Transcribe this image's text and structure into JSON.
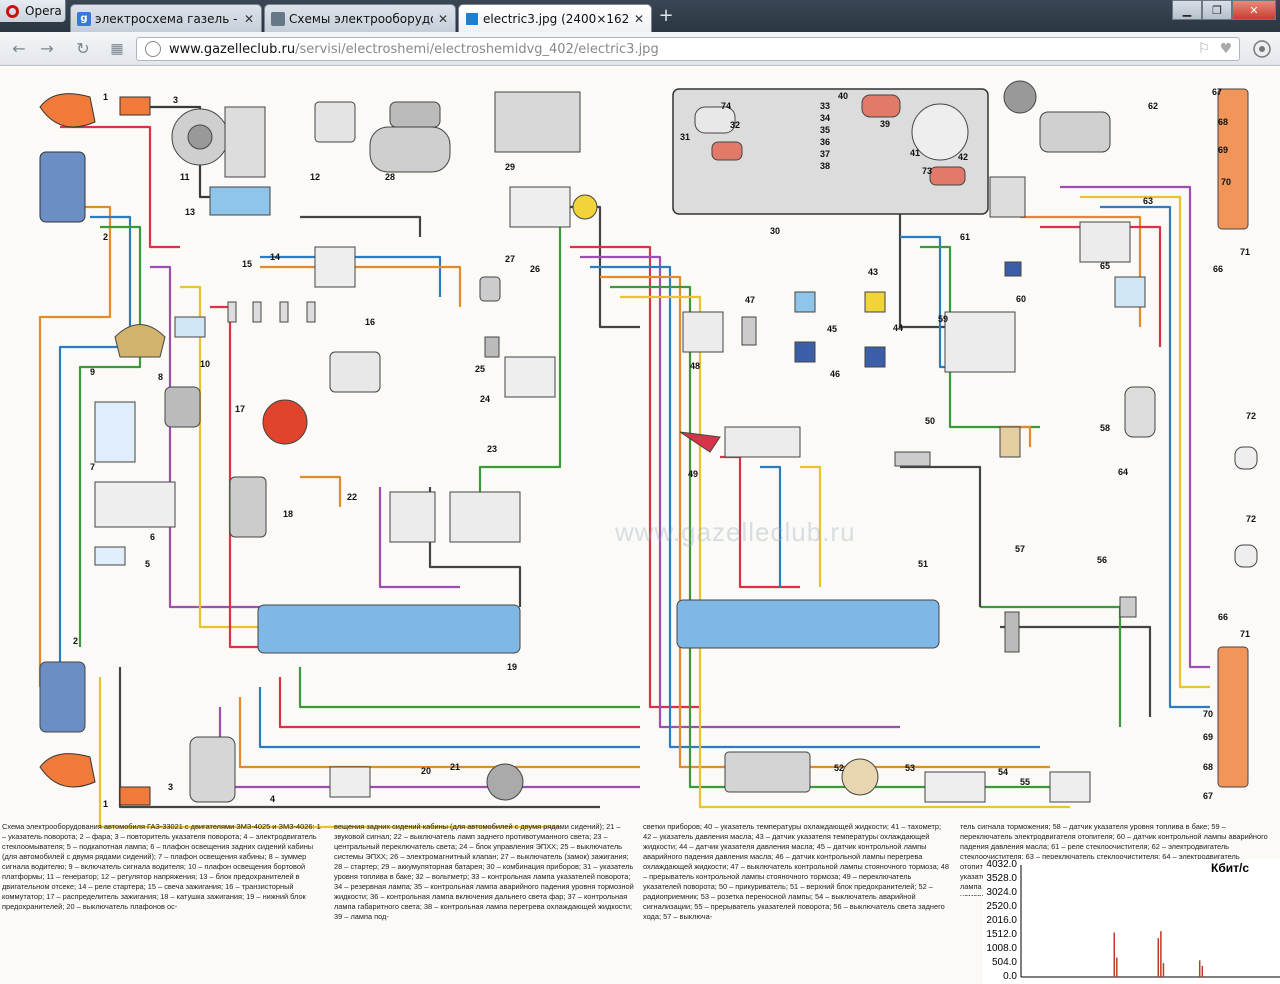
{
  "browser": {
    "menu_label": "Opera",
    "tabs": [
      {
        "title": "электросхема газель - По",
        "icon": "google-icon",
        "active": false
      },
      {
        "title": "Схемы электрооборудова",
        "icon": "page-icon",
        "active": false
      },
      {
        "title": "electric3.jpg (2400×1624)",
        "icon": "image-icon",
        "active": true
      }
    ],
    "new_tab_label": "+",
    "url_host": "www.gazelleclub.ru",
    "url_path": "/servisi/electroshemi/electroshemidvg_402/electric3.jpg"
  },
  "diagram": {
    "watermark": "www.gazelleclub.ru",
    "labels_left": [
      "1",
      "3",
      "2",
      "11",
      "12",
      "28",
      "29",
      "13",
      "14",
      "15",
      "27",
      "26",
      "9",
      "10",
      "16",
      "25",
      "24",
      "8",
      "7",
      "17",
      "23",
      "22",
      "18",
      "6",
      "5",
      "19",
      "2",
      "21",
      "20",
      "3",
      "1",
      "4"
    ],
    "labels_right": [
      "74",
      "33",
      "34",
      "35",
      "36",
      "37",
      "38",
      "31",
      "32",
      "30",
      "40",
      "39",
      "41",
      "42",
      "73",
      "62",
      "67",
      "68",
      "69",
      "70",
      "66",
      "71",
      "63",
      "61",
      "60",
      "43",
      "45",
      "44",
      "46",
      "47",
      "48",
      "65",
      "59",
      "64",
      "72",
      "58",
      "50",
      "49",
      "51",
      "57",
      "56",
      "52",
      "53",
      "54",
      "55",
      "66",
      "71",
      "70",
      "69",
      "68",
      "67"
    ],
    "caption": {
      "col1": "Схема электрооборудования автомобиля ГАЗ-33021 с двигателями ЗМЗ-4025 и ЗМЗ-4026: 1 – указатель поворота; 2 – фара; 3 – повторитель указателя поворота; 4 – электродвигатель стеклоомывателя; 5 – подкапотная лампа; 6 – плафон освещения задних сидений кабины (для автомобилей с двумя рядами сидений); 7 – плафон освещения кабины; 8 – зуммер сигнала водителю; 9 – включатель сигнала водителя; 10 – плафон освещения бортовой платформы; 11 – генератор; 12 – регулятор напряжения; 13 – блок предохранителей в двигательном отсеке; 14 – реле стартера; 15 – свеча зажигания; 16 – транзисторный коммутатор; 17 – распределитель зажигания; 18 – катушка зажигания; 19 – нижний блок предохранителей; 20 – выключатель плафонов ос-",
      "col2": "вещения задних сидений кабины (для автомобилей с двумя рядами сидений); 21 – звуковой сигнал; 22 – выключатель ламп заднего противотуманного света; 23 – центральный переключатель света; 24 – блок управления ЭПХХ; 25 – выключатель системы ЭПХХ; 26 – электромагнитный клапан; 27 – выключатель (замок) зажигания; 28 – стартер; 29 – аккумуляторная батарея; 30 – комбинация приборов; 31 – указатель уровня топлива в баке; 32 – вольтметр; 33 – контрольная лампа указателей поворота; 34 – резервная лампа; 35 – контрольная лампа аварийного падения уровня тормозной жидкости; 36 – контрольная лампа включения дальнего света фар; 37 – контрольная лампа габаритного света; 38 – контрольная лампа перегрева охлаждающей жидкости; 39 – лампа под-",
      "col3": "светки приборов; 40 – указатель температуры охлаждающей жидкости; 41 – тахометр; 42 – указатель давления масла; 43 – датчик указателя температуры охлаждающей жидкости; 44 – датчик указателя давления масла; 45 – датчик контрольной лампы аварийного падения давления масла; 46 – датчик контрольной лампы перегрева охлаждающей жидкости; 47 – выключатель контрольной лампы стояночного тормоза; 48 – прерыватель контрольной лампы стояночного тормоза; 49 – переключатель указателей поворота; 50 – прикуриватель; 51 – верхний блок предохранителей; 52 – радиоприемник; 53 – розетка переносной лампы; 54 – выключатель аварийной сигнализации; 55 – прерыватель указателей поворота; 56 – выключатель света заднего хода; 57 – выключа-",
      "col4": "тель сигнала торможения; 58 – датчик указателя уровня топлива в баке; 59 – переключатель электродвигателя отопителя; 60 – датчик контрольной лампы аварийного падения давления масла; 61 – реле стеклоочистителя; 62 – электродвигатель стеклоочистителя; 63 – переключатель стеклоочистителя; 64 – электродвигатель отопителя; 65 – резистор электродвигателя отопителя; 66 – задний фонарь; 67 – лампа указателя поворота; 68 – лампа габаритного света; 69 – лампа сигнала торможения; 70 – лампа света заднего хода; 71 – лампа противотуманного света; 72 – фонарь освещения номерного знака; 73 – контрольная лампа аварийного падения давления масла; 74 – контрольная лампа минимального резерва топлива в баке."
    }
  },
  "graph": {
    "title": "Кбит/с",
    "y_ticks": [
      "4032.0",
      "3528.0",
      "3024.0",
      "2520.0",
      "2016.0",
      "1512.0",
      "1008.0",
      "504.0",
      "0.0"
    ],
    "ymax": 4032,
    "spikes": [
      {
        "x": 0.36,
        "v": 1600
      },
      {
        "x": 0.37,
        "v": 700
      },
      {
        "x": 0.53,
        "v": 1400
      },
      {
        "x": 0.54,
        "v": 1650
      },
      {
        "x": 0.55,
        "v": 500
      },
      {
        "x": 0.69,
        "v": 600
      },
      {
        "x": 0.7,
        "v": 400
      }
    ],
    "color": "#c0392b"
  }
}
